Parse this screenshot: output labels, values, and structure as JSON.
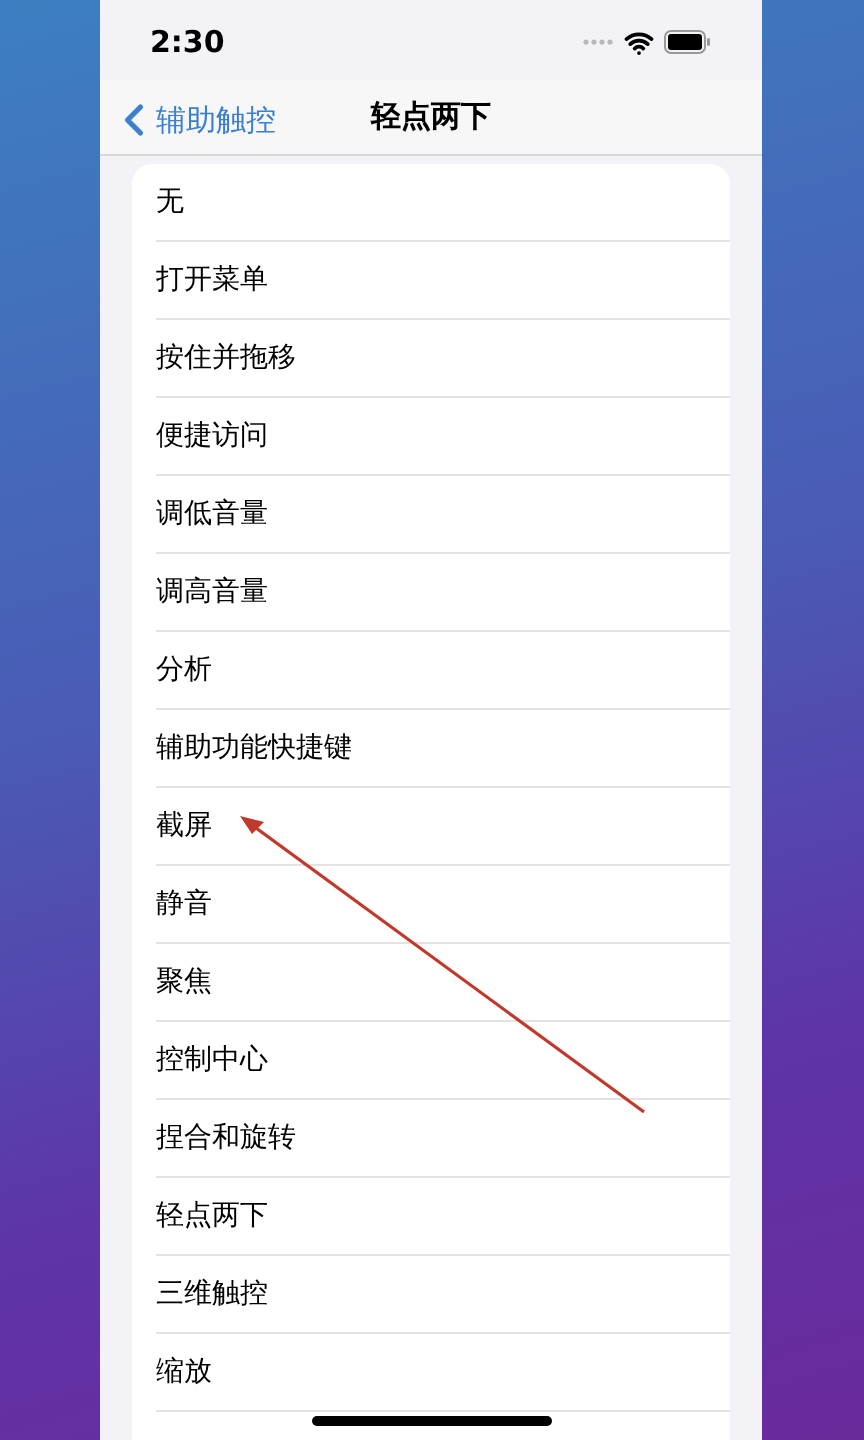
{
  "status_bar": {
    "time": "2:30"
  },
  "nav": {
    "back": "辅助触控",
    "title": "轻点两下"
  },
  "items": [
    {
      "label": "无"
    },
    {
      "label": "打开菜单"
    },
    {
      "label": "按住并拖移"
    },
    {
      "label": "便捷访问"
    },
    {
      "label": "调低音量"
    },
    {
      "label": "调高音量"
    },
    {
      "label": "分析"
    },
    {
      "label": "辅助功能快捷键"
    },
    {
      "label": "截屏"
    },
    {
      "label": "静音"
    },
    {
      "label": "聚焦"
    },
    {
      "label": "控制中心"
    },
    {
      "label": "捏合和旋转"
    },
    {
      "label": "轻点两下"
    },
    {
      "label": "三维触控"
    },
    {
      "label": "缩放"
    }
  ]
}
